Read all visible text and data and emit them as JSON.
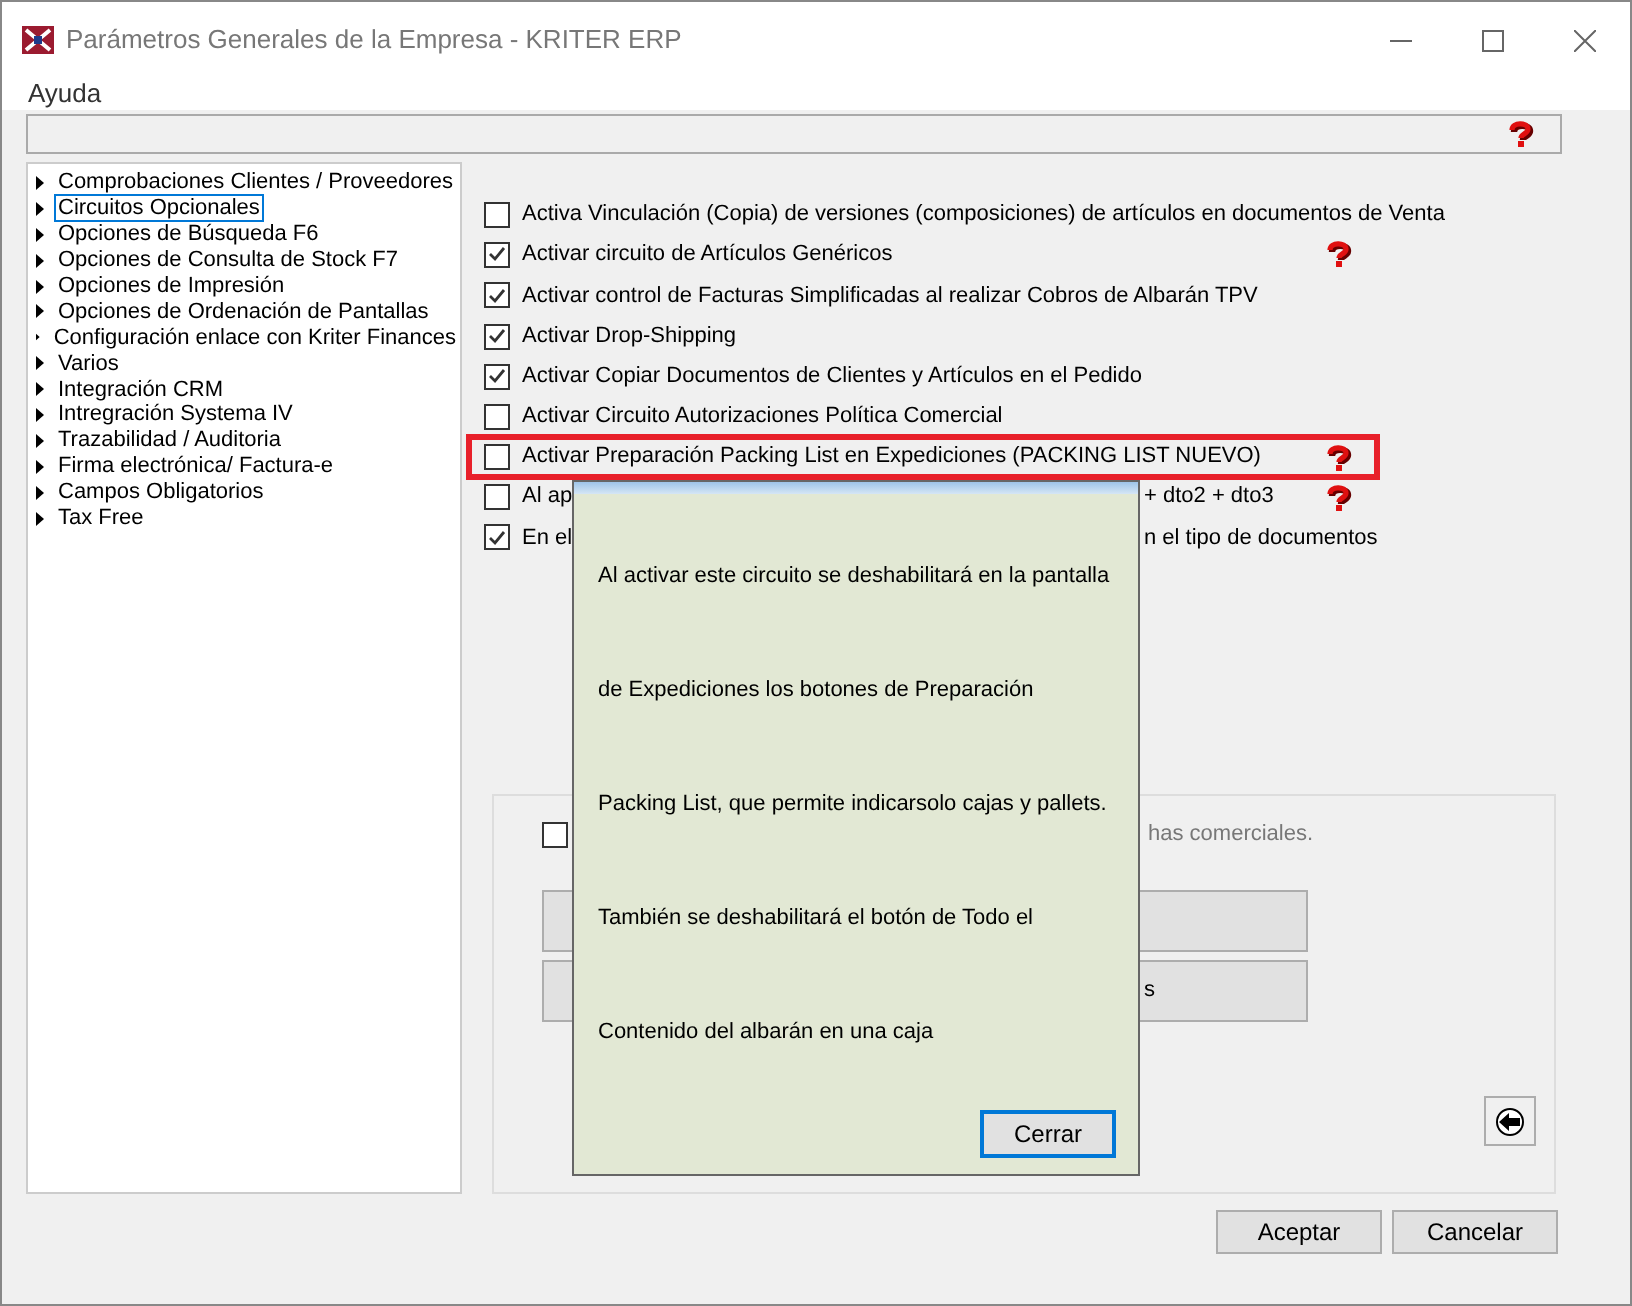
{
  "window": {
    "title": "Parámetros Generales de la Empresa - KRITER ERP"
  },
  "menu": [
    "Ayuda"
  ],
  "tree": [
    {
      "label": "Comprobaciones Clientes / Proveedores",
      "selected": false
    },
    {
      "label": "Circuitos Opcionales",
      "selected": true
    },
    {
      "label": "Opciones de Búsqueda F6",
      "selected": false
    },
    {
      "label": "Opciones de Consulta de Stock F7",
      "selected": false
    },
    {
      "label": "Opciones de Impresión",
      "selected": false
    },
    {
      "label": "Opciones de Ordenación de Pantallas",
      "selected": false
    },
    {
      "label": "Configuración enlace con Kriter Finances",
      "selected": false
    },
    {
      "label": "Varios",
      "selected": false
    },
    {
      "label": "Integración CRM",
      "selected": false
    },
    {
      "label": "Intregración Systema IV",
      "selected": false
    },
    {
      "label": "Trazabilidad / Auditoria",
      "selected": false
    },
    {
      "label": "Firma electrónica/ Factura-e",
      "selected": false
    },
    {
      "label": "Campos Obligatorios",
      "selected": false
    },
    {
      "label": "Tax Free",
      "selected": false
    }
  ],
  "options": [
    {
      "label": "Activa Vinculación (Copia) de versiones (composiciones) de artículos en documentos de Venta",
      "checked": false,
      "help": false,
      "highlighted": false
    },
    {
      "label": "Activar circuito de Artículos Genéricos",
      "checked": true,
      "help": true,
      "highlighted": false
    },
    {
      "label": "Activar control de Facturas Simplificadas al realizar Cobros de Albarán TPV",
      "checked": true,
      "help": false,
      "highlighted": false
    },
    {
      "label": "Activar Drop-Shipping",
      "checked": true,
      "help": false,
      "highlighted": false
    },
    {
      "label": "Activar Copiar Documentos de Clientes y Artículos en el Pedido",
      "checked": true,
      "help": false,
      "highlighted": false
    },
    {
      "label": "Activar Circuito Autorizaciones Política Comercial",
      "checked": false,
      "help": false,
      "highlighted": false
    },
    {
      "label": "Activar Preparación Packing List en Expediciones (PACKING LIST NUEVO)",
      "checked": false,
      "help": true,
      "highlighted": true
    },
    {
      "label": "Al ap",
      "label_end": "+ dto2 + dto3",
      "checked": false,
      "help": true,
      "highlighted": false
    },
    {
      "label": "En el",
      "label_end": "n el tipo de documentos",
      "checked": true,
      "help": false,
      "highlighted": false
    }
  ],
  "group": {
    "checkbox_label_end": "has comerciales.",
    "checked": false,
    "buttons": [
      {
        "kind": "blank"
      },
      {
        "kind": "text",
        "label": "s"
      }
    ]
  },
  "popup": {
    "lines": [
      "Al activar este circuito se deshabilitará en la pantalla",
      "de Expediciones los botones de Preparación",
      "Packing List, que permite indicarsolo cajas y pallets.",
      "También se deshabilitará el botón de Todo el",
      "Contenido del albarán en una caja"
    ],
    "button": "Cerrar"
  },
  "buttons": [
    "Aceptar",
    "Cancelar"
  ]
}
